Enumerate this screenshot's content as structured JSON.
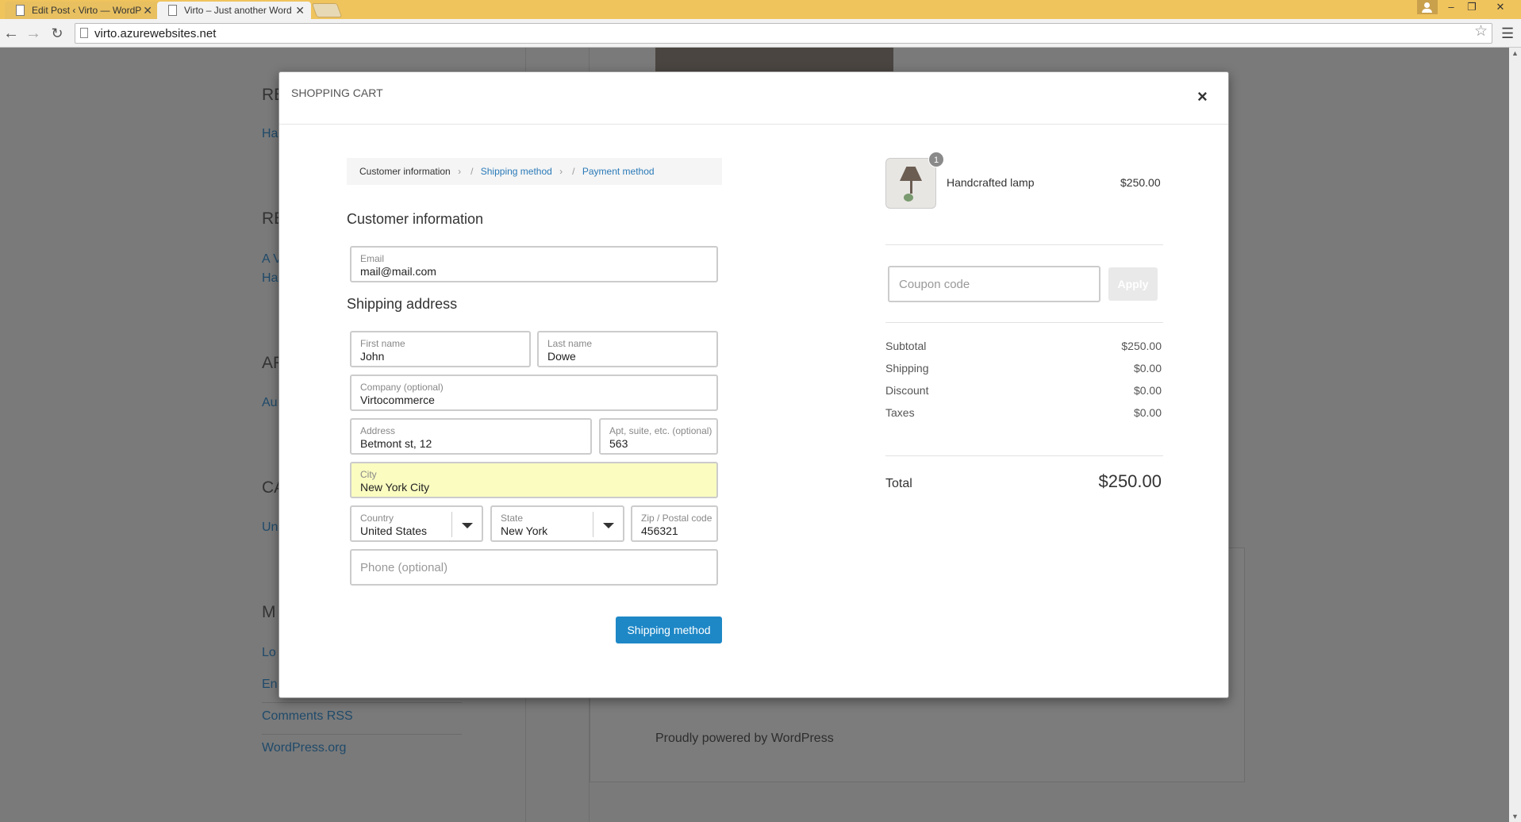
{
  "browser": {
    "tabs": [
      {
        "title": "Edit Post ‹ Virto — WordP",
        "active": false
      },
      {
        "title": "Virto – Just another Word",
        "active": true
      }
    ],
    "url": "virto.azurewebsites.net",
    "icons": [
      "back-icon",
      "forward-icon",
      "reload-icon",
      "star-icon",
      "menu-icon"
    ]
  },
  "background_page": {
    "headings": [
      "RE",
      "RE",
      "AR",
      "CA",
      "M"
    ],
    "links": [
      "Ha",
      "A V",
      "Ha",
      "Au",
      "Un",
      "Lo",
      "En",
      "Comments RSS",
      "WordPress.org"
    ],
    "footer": "Proudly powered by WordPress"
  },
  "modal": {
    "title": "SHOPPING CART",
    "close": "×",
    "breadcrumb": [
      {
        "label": "Customer information",
        "current": true
      },
      {
        "label": "Shipping method",
        "current": false
      },
      {
        "label": "Payment method",
        "current": false
      }
    ],
    "customer_section": "Customer information",
    "email": {
      "label": "Email",
      "value": "mail@mail.com"
    },
    "shipping_section": "Shipping address",
    "first_name": {
      "label": "First name",
      "value": "John"
    },
    "last_name": {
      "label": "Last name",
      "value": "Dowe"
    },
    "company": {
      "label": "Company (optional)",
      "value": "Virtocommerce"
    },
    "address": {
      "label": "Address",
      "value": "Betmont st, 12"
    },
    "apt": {
      "label": "Apt, suite, etc. (optional)",
      "value": "563"
    },
    "city": {
      "label": "City",
      "value": "New York City"
    },
    "country": {
      "label": "Country",
      "value": "United States"
    },
    "state": {
      "label": "State",
      "value": "New York"
    },
    "zip": {
      "label": "Zip / Postal code",
      "value": "456321"
    },
    "phone": {
      "placeholder": "Phone (optional)"
    },
    "next_button": "Shipping method"
  },
  "summary": {
    "item": {
      "name": "Handcrafted lamp",
      "price": "$250.00",
      "quantity": "1"
    },
    "coupon_placeholder": "Coupon code",
    "apply_label": "Apply",
    "lines": [
      {
        "label": "Subtotal",
        "value": "$250.00"
      },
      {
        "label": "Shipping",
        "value": "$0.00"
      },
      {
        "label": "Discount",
        "value": "$0.00"
      },
      {
        "label": "Taxes",
        "value": "$0.00"
      }
    ],
    "total_label": "Total",
    "total_value": "$250.00"
  },
  "colors": {
    "accent": "#1e88c7",
    "link": "#2a7ab8",
    "highlight_field": "#fafcc0",
    "titlebar": "#f0c45d"
  }
}
